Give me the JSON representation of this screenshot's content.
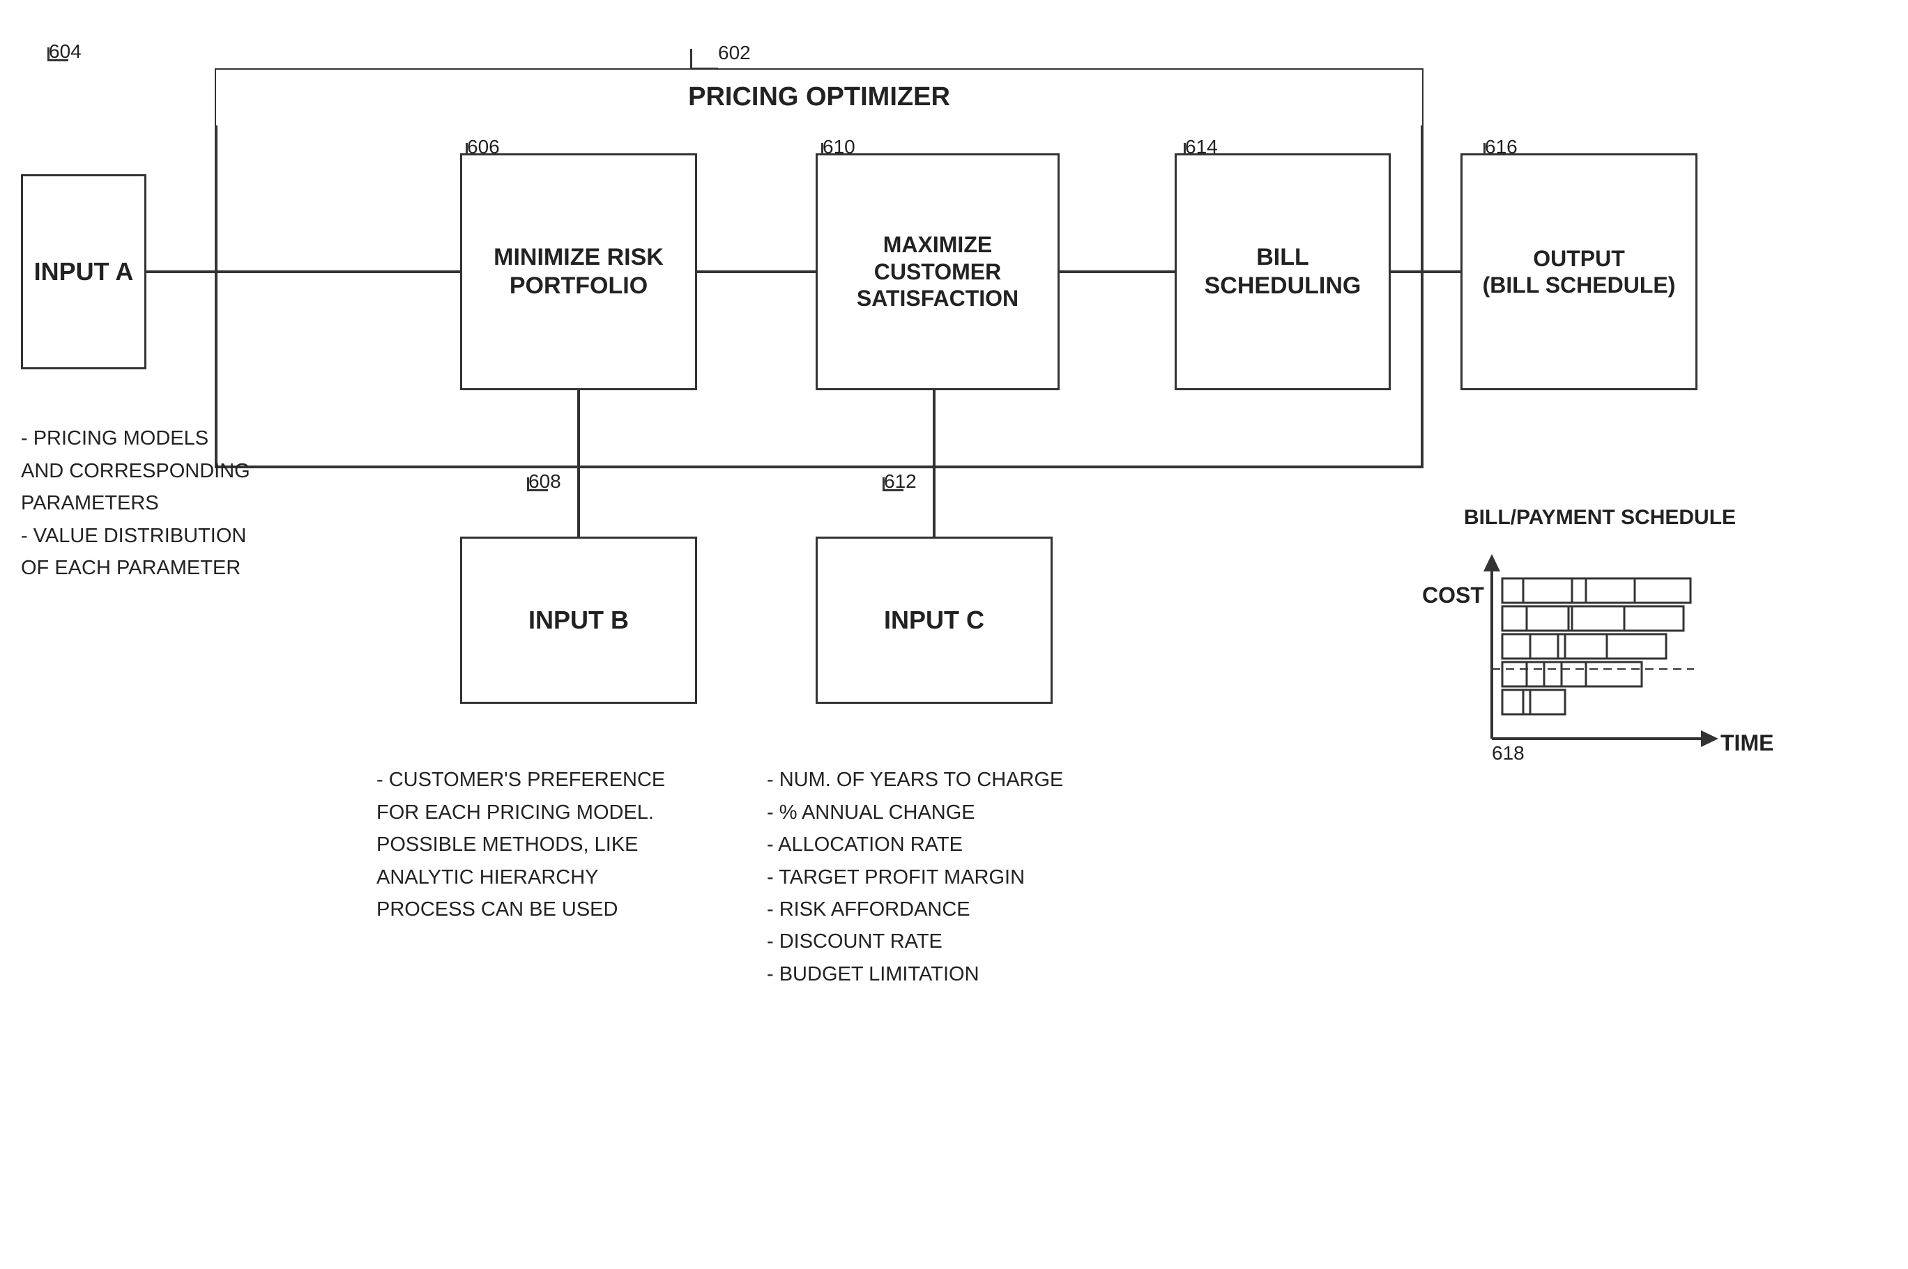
{
  "diagram": {
    "title": "PRICING OPTIMIZER",
    "ref_pricing_optimizer": "602",
    "ref_input_a": "604",
    "ref_minimize": "606",
    "ref_input_b": "608",
    "ref_maximize": "610",
    "ref_input_c": "612",
    "ref_bill_scheduling": "614",
    "ref_output": "616",
    "ref_chart": "618",
    "boxes": {
      "input_a": "INPUT A",
      "minimize": "MINIMIZE RISK\nPORTFOLIO",
      "maximize": "MAXIMIZE\nCUSTOMER\nSATISFACTION",
      "bill_scheduling": "BILL\nSCHEDULING",
      "output": "OUTPUT\n(BILL SCHEDULE)",
      "input_b": "INPUT B",
      "input_c": "INPUT C"
    },
    "labels": {
      "input_a_desc": "- PRICING MODELS\nAND CORRESPONDING\nPARAMETERS\n- VALUE DISTRIBUTION\nOF EACH PARAMETER",
      "input_b_desc": "- CUSTOMER'S PREFERENCE\nFOR EACH PRICING MODEL.\nPOSSIBLE METHODS, LIKE\nANALYTIC HIERARCHY\nPROCESS CAN BE USED",
      "input_c_desc": "- NUM. OF YEARS TO CHARGE\n- % ANNUAL CHANGE\n- ALLOCATION RATE\n- TARGET PROFIT MARGIN\n- RISK AFFORDANCE\n- DISCOUNT RATE\n- BUDGET LIMITATION",
      "bill_payment": "BILL/PAYMENT SCHEDULE",
      "cost": "COST",
      "time": "TIME"
    }
  }
}
